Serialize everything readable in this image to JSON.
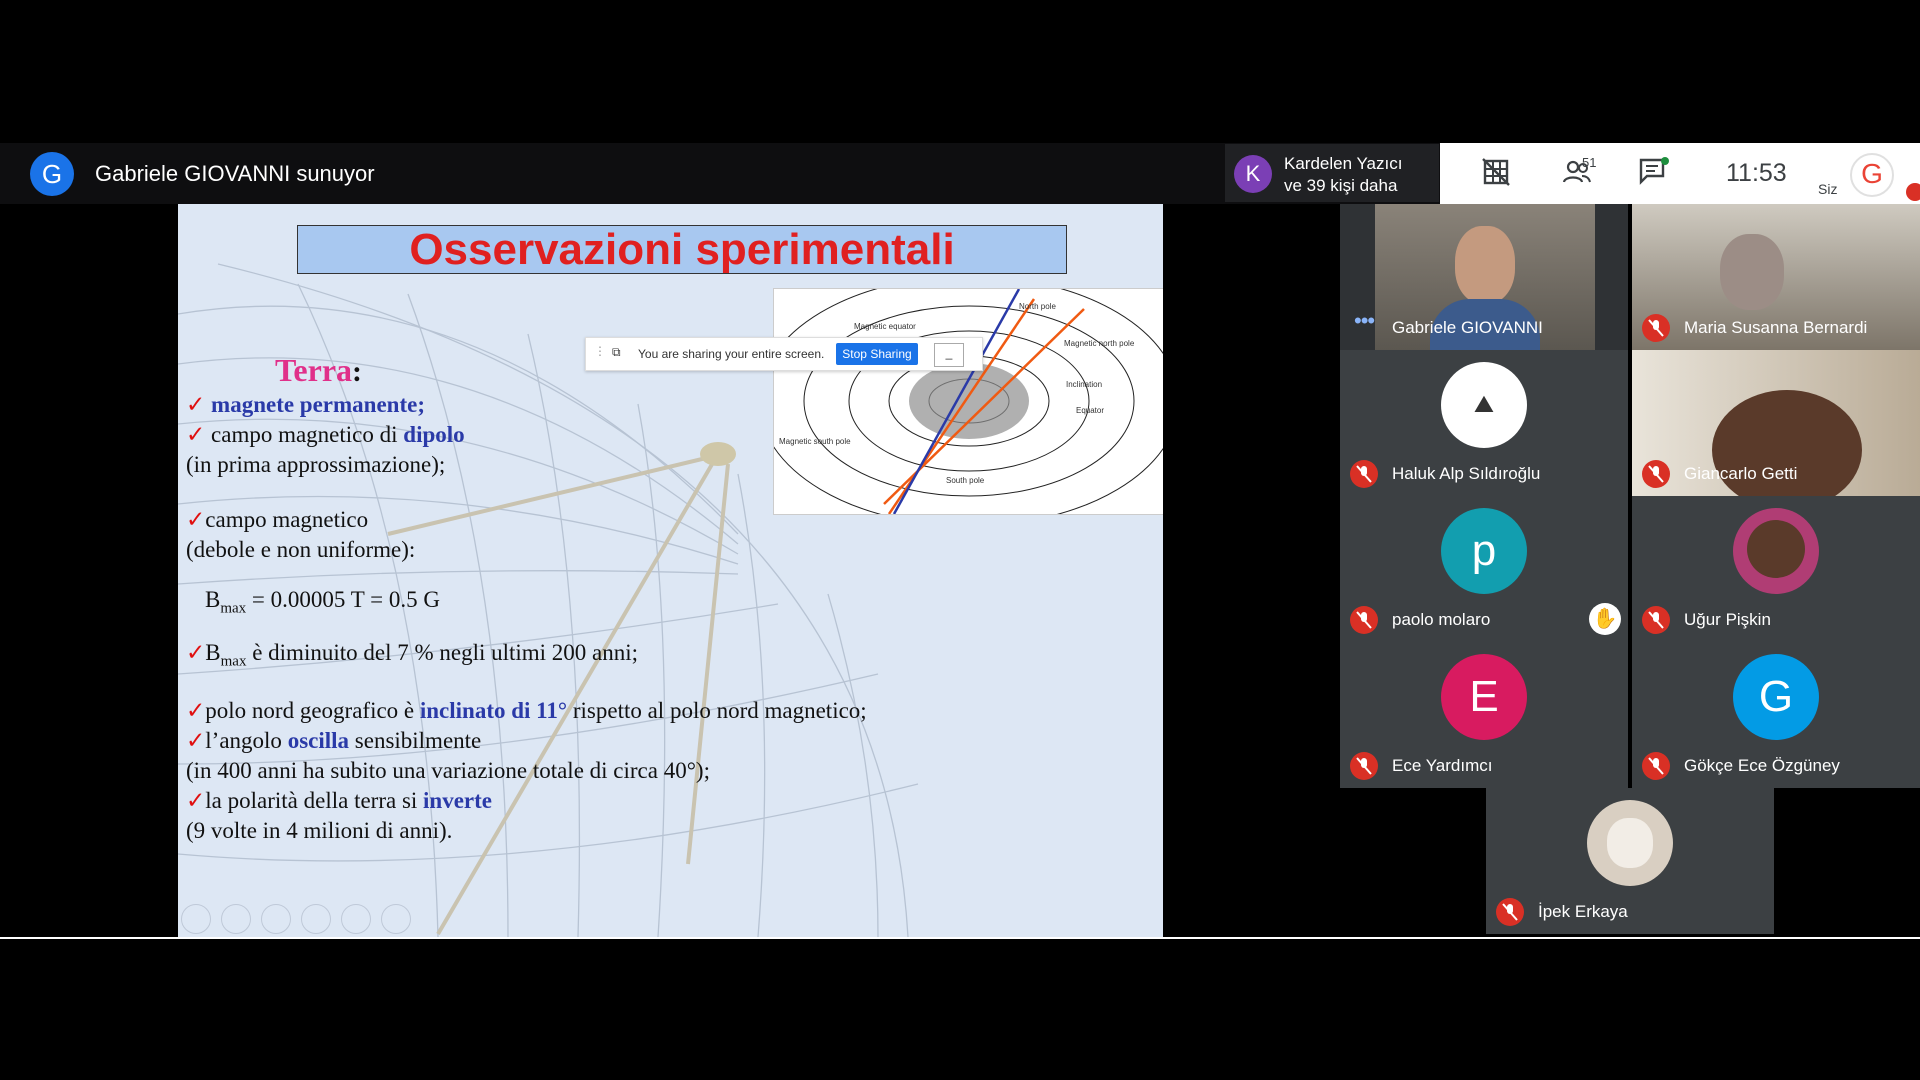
{
  "top_bar": {
    "presenter_initial": "G",
    "presenter_title": "Gabriele GIOVANNI sunuyor",
    "joined_initial": "K",
    "joined_line1": "Kardelen Yazıcı",
    "joined_line2": "ve 39 kişi daha",
    "participants_count": "51",
    "time": "11:53",
    "self_label": "Siz"
  },
  "slide": {
    "title": "Osservazioni sperimentali",
    "share_bar": {
      "text": "You are sharing your entire screen.",
      "stop_label": "Stop Sharing",
      "hide_label": "_"
    },
    "terra": "Terra",
    "colon": ":",
    "line1": "magnete permanente;",
    "line2a": "campo magnetico di ",
    "line2b": "dipolo",
    "line3": "(in prima approssimazione);",
    "line4": "campo magnetico",
    "line5": "(debole e non uniforme):",
    "line6a": "B",
    "line6sub": "max",
    "line6b": " = 0.00005 T = 0.5 G",
    "line7a": "B",
    "line7sub": "max",
    "line7b": "  è diminuito del 7 % negli ultimi 200 anni;",
    "line8a": "polo nord geografico è ",
    "line8b": "inclinato di 11°",
    "line8c": " rispetto al polo nord magnetico;",
    "line9a": "l’angolo ",
    "line9b": "oscilla",
    "line9c": " sensibilmente",
    "line10": "(in 400 anni ha subito una variazione totale di circa 40°);",
    "line11a": "la polarità della terra si ",
    "line11b": "inverte",
    "line12": "(9 volte in 4 milioni di anni).",
    "check": "✓",
    "diagram_labels": {
      "north_pole": "North pole",
      "magnetic_equator": "Magnetic equator",
      "magnetic_north_pole": "Magnetic north pole",
      "inclination": "Inclination",
      "equator": "Equator",
      "magnetic_south_pole": "Magnetic south pole",
      "south_pole": "South pole"
    }
  },
  "participants": [
    {
      "name": "Gabriele GIOVANNI",
      "type": "video",
      "muted": false
    },
    {
      "name": "Maria Susanna Bernardi",
      "type": "video",
      "muted": true
    },
    {
      "name": "Haluk Alp Sıldıroğlu",
      "type": "avatar",
      "muted": true
    },
    {
      "name": "Giancarlo Getti",
      "type": "video",
      "muted": true
    },
    {
      "name": "paolo molaro",
      "type": "initial",
      "initial": "p",
      "color": "#129eaf",
      "muted": true
    },
    {
      "name": "Uğur Pişkin",
      "type": "avatar",
      "muted": true
    },
    {
      "name": "Ece Yardımcı",
      "type": "initial",
      "initial": "E",
      "color": "#d81b60",
      "muted": true
    },
    {
      "name": "Gökçe Ece Özgüney",
      "type": "initial",
      "initial": "G",
      "color": "#039be5",
      "muted": true
    },
    {
      "name": "İpek Erkaya",
      "type": "avatar",
      "muted": true
    }
  ],
  "colors": {
    "accent": "#1a73e8",
    "muted_red": "#d93025",
    "title_red": "#e02020"
  }
}
